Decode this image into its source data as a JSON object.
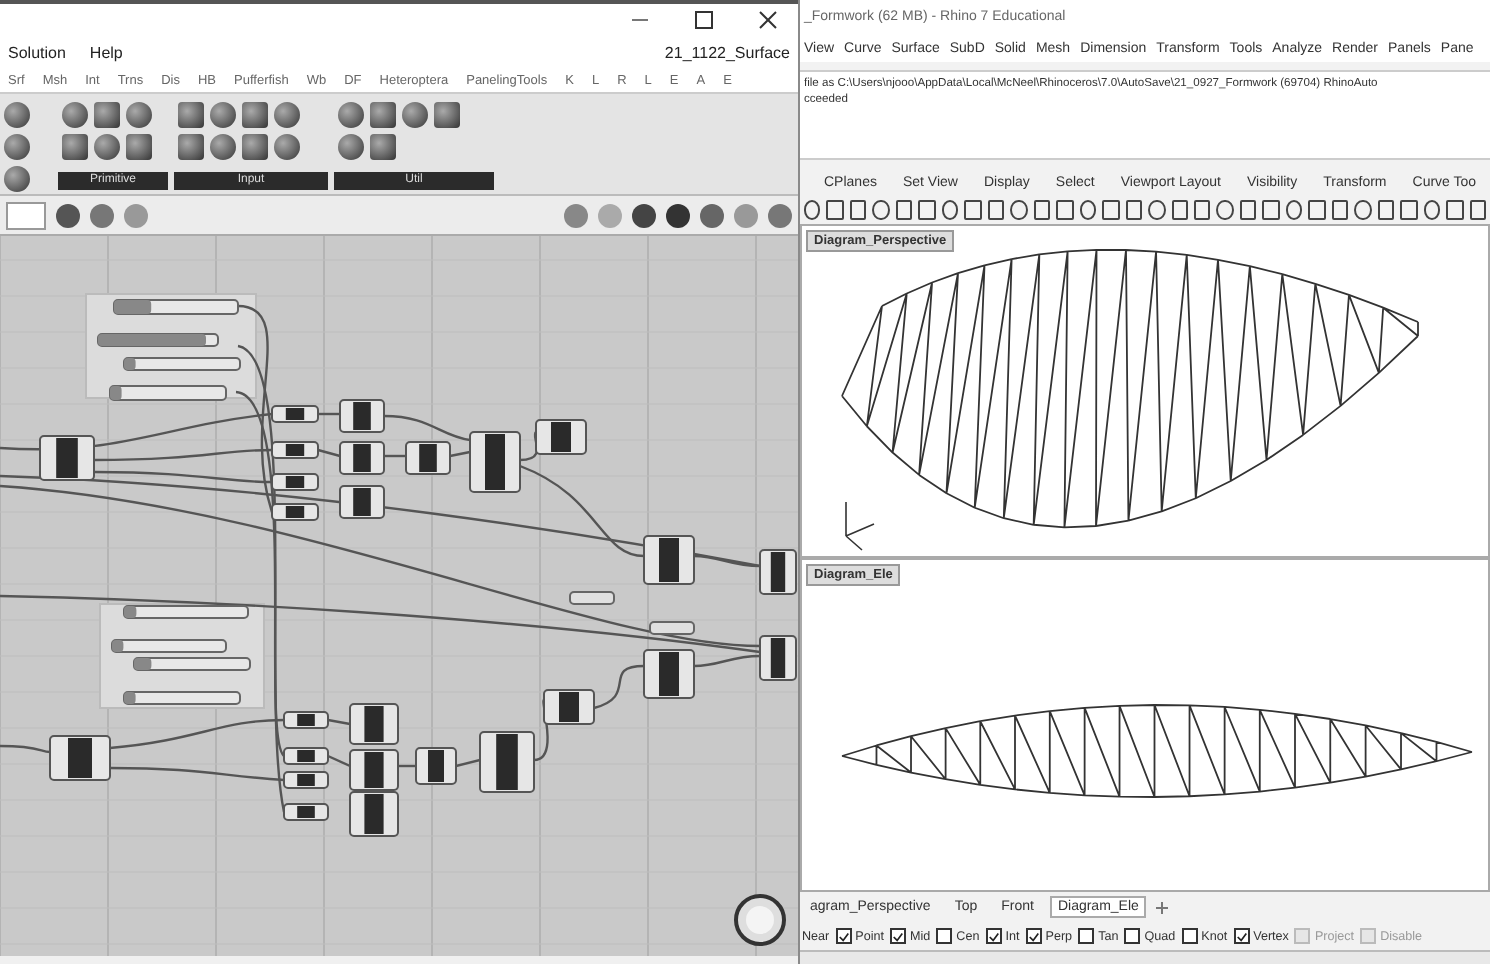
{
  "grasshopper": {
    "menu": [
      {
        "label": "Solution"
      },
      {
        "label": "Help"
      }
    ],
    "document_title": "21_1122_Surface",
    "tabs": [
      {
        "label": "Srf"
      },
      {
        "label": "Msh"
      },
      {
        "label": "Int"
      },
      {
        "label": "Trns"
      },
      {
        "label": "Dis"
      },
      {
        "label": "HB"
      },
      {
        "label": "Pufferfish"
      },
      {
        "label": "Wb"
      },
      {
        "label": "DF"
      },
      {
        "label": "Heteroptera"
      },
      {
        "label": "PanelingTools"
      },
      {
        "label": "K"
      },
      {
        "label": "L"
      },
      {
        "label": "R"
      },
      {
        "label": "L"
      },
      {
        "label": "E"
      },
      {
        "label": "A"
      },
      {
        "label": "E"
      }
    ],
    "ribbon_groups": [
      {
        "label": "Primitive"
      },
      {
        "label": "Input"
      },
      {
        "label": "Util"
      }
    ],
    "sliders": [
      {
        "level": 0.3
      },
      {
        "level": 0.9
      },
      {
        "level": 0.1
      },
      {
        "level": 0.1
      },
      {
        "level": 0.1
      },
      {
        "level": 0.1
      },
      {
        "level": 0.15
      },
      {
        "level": 0.1
      }
    ]
  },
  "rhino": {
    "title": "_Formwork (62 MB) - Rhino 7 Educational",
    "menu": [
      {
        "label": "View"
      },
      {
        "label": "Curve"
      },
      {
        "label": "Surface"
      },
      {
        "label": "SubD"
      },
      {
        "label": "Solid"
      },
      {
        "label": "Mesh"
      },
      {
        "label": "Dimension"
      },
      {
        "label": "Transform"
      },
      {
        "label": "Tools"
      },
      {
        "label": "Analyze"
      },
      {
        "label": "Render"
      },
      {
        "label": "Panels"
      },
      {
        "label": "Pane"
      }
    ],
    "command_history": [
      "file as C:\\Users\\njooo\\AppData\\Local\\McNeel\\Rhinoceros\\7.0\\AutoSave\\21_0927_Formwork (69704) RhinoAuto",
      "cceeded"
    ],
    "toolbar_tabs": [
      {
        "label": "CPlanes"
      },
      {
        "label": "Set View"
      },
      {
        "label": "Display"
      },
      {
        "label": "Select"
      },
      {
        "label": "Viewport Layout"
      },
      {
        "label": "Visibility"
      },
      {
        "label": "Transform"
      },
      {
        "label": "Curve Too"
      }
    ],
    "viewports": [
      {
        "label": "Diagram_Perspective",
        "kind": "perspective"
      },
      {
        "label": "Diagram_Ele",
        "kind": "elevation"
      }
    ],
    "viewport_tabs": [
      {
        "label": "agram_Perspective",
        "selected": false
      },
      {
        "label": "Top",
        "selected": false
      },
      {
        "label": "Front",
        "selected": false
      },
      {
        "label": "Diagram_Ele",
        "selected": true
      }
    ],
    "osnap_cut_label": "Near",
    "osnaps": [
      {
        "label": "Point",
        "checked": true,
        "disabled": false
      },
      {
        "label": "Mid",
        "checked": true,
        "disabled": false
      },
      {
        "label": "Cen",
        "checked": false,
        "disabled": false
      },
      {
        "label": "Int",
        "checked": true,
        "disabled": false
      },
      {
        "label": "Perp",
        "checked": true,
        "disabled": false
      },
      {
        "label": "Tan",
        "checked": false,
        "disabled": false
      },
      {
        "label": "Quad",
        "checked": false,
        "disabled": false
      },
      {
        "label": "Knot",
        "checked": false,
        "disabled": false
      },
      {
        "label": "Vertex",
        "checked": true,
        "disabled": false
      },
      {
        "label": "Project",
        "checked": false,
        "disabled": true
      },
      {
        "label": "Disable",
        "checked": false,
        "disabled": true
      }
    ]
  }
}
